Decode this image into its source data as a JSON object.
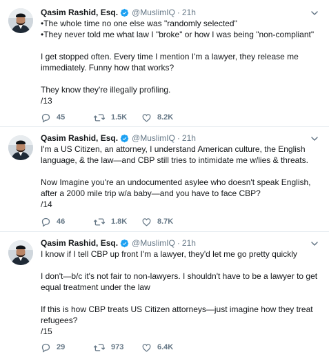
{
  "tweets": [
    {
      "name": "Qasim Rashid, Esq.",
      "handle": "@MuslimIQ",
      "separator": "·",
      "time": "21h",
      "text": "•The whole time no one else was \"randomly selected\"\n•They never told me what law I \"broke\" or how I was being \"non-compliant\"\n\nI get stopped often. Every time I mention I'm a lawyer, they release me immediately. Funny how that works?\n\nThey know they're illegally profiling.\n/13",
      "replies": "45",
      "retweets": "1.5K",
      "likes": "8.2K"
    },
    {
      "name": "Qasim Rashid, Esq.",
      "handle": "@MuslimIQ",
      "separator": "·",
      "time": "21h",
      "text": "I'm a US Citizen, an attorney, I understand American culture, the English language, & the law—and CBP still tries to intimidate me w/lies & threats.\n\nNow Imagine you're an undocumented asylee who doesn't speak English, after a 2000 mile trip w/a baby—and you have to face CBP?\n/14",
      "replies": "46",
      "retweets": "1.8K",
      "likes": "8.7K"
    },
    {
      "name": "Qasim Rashid, Esq.",
      "handle": "@MuslimIQ",
      "separator": "·",
      "time": "21h",
      "text": "I know if I tell CBP up front I'm a lawyer, they'd let me go pretty quickly\n\nI don't—b/c it's not fair to non-lawyers. I shouldn't have to be a lawyer to get equal treatment under the law\n\nIf this is how CBP treats US Citizen attorneys—just imagine how they treat refugees?\n/15",
      "replies": "29",
      "retweets": "973",
      "likes": "6.4K"
    }
  ],
  "colors": {
    "text": "#14171a",
    "muted": "#657786",
    "verified": "#1da1f2",
    "divider": "#e6ecf0"
  },
  "icons": {
    "reply": "reply-icon",
    "retweet": "retweet-icon",
    "like": "heart-icon",
    "verified": "verified-badge-icon",
    "menu": "chevron-down-icon"
  }
}
